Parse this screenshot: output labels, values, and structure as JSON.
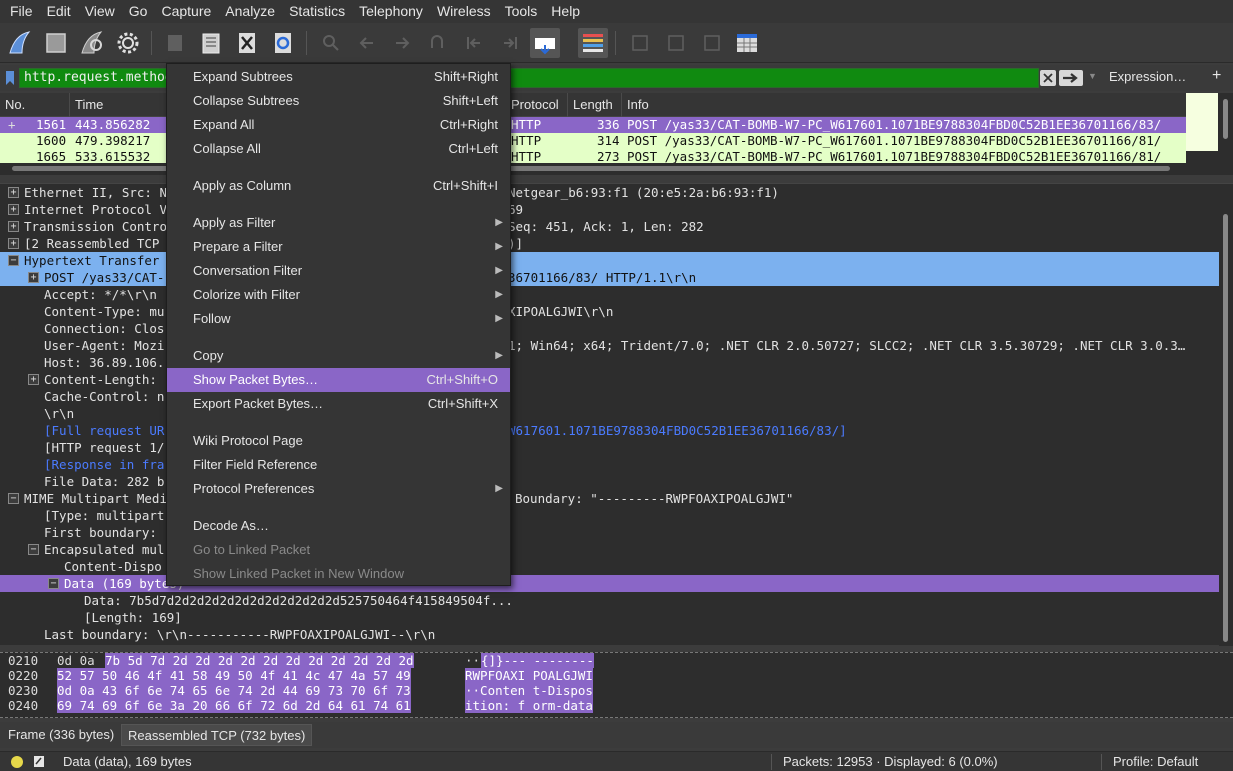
{
  "menubar": [
    "File",
    "Edit",
    "View",
    "Go",
    "Capture",
    "Analyze",
    "Statistics",
    "Telephony",
    "Wireless",
    "Tools",
    "Help"
  ],
  "toolbar": {
    "icons": [
      "shark-fin-start-icon",
      "stop-capture-icon",
      "restart-capture-icon",
      "capture-options-icon",
      "open-file-icon",
      "save-file-icon",
      "close-file-icon",
      "reload-file-icon",
      "find-packet-icon",
      "go-back-icon",
      "go-forward-icon",
      "go-to-packet-icon",
      "first-packet-icon",
      "last-packet-icon",
      "autoscroll-icon",
      "colorize-icon",
      "zoom-in-icon",
      "zoom-out-icon",
      "normal-size-icon",
      "resize-columns-icon"
    ]
  },
  "filter": {
    "value": "http.request.method ==",
    "expression_label": "Expression…",
    "add_label": "+"
  },
  "packet_list": {
    "columns": [
      "No.",
      "Time",
      "Protocol",
      "Length",
      "Info"
    ],
    "rows": [
      {
        "no": "1561",
        "time": "443.856282",
        "protocol": "HTTP",
        "length": "336",
        "info": "POST /yas33/CAT-BOMB-W7-PC_W617601.1071BE9788304FBD0C52B1EE36701166/83/"
      },
      {
        "no": "1600",
        "time": "479.398217",
        "protocol": "HTTP",
        "length": "314",
        "info": "POST /yas33/CAT-BOMB-W7-PC_W617601.1071BE9788304FBD0C52B1EE36701166/81/"
      },
      {
        "no": "1665",
        "time": "533.615532",
        "protocol": "HTTP",
        "length": "273",
        "info": "POST /yas33/CAT-BOMB-W7-PC_W617601.1071BE9788304FBD0C52B1EE36701166/81/"
      }
    ]
  },
  "details": {
    "rows": [
      {
        "left": "Ethernet II, Src: N",
        "right": "Netgear_b6:93:f1 (20:e5:2a:b6:93:f1)"
      },
      {
        "left": "Internet Protocol V",
        "right": "69"
      },
      {
        "left": "Transmission Contro",
        "right": "Seq: 451, Ack: 1, Len: 282"
      },
      {
        "left": "[2 Reassembled TCP",
        "right": ")]"
      },
      {
        "left": "Hypertext Transfer",
        "right": ""
      },
      {
        "left": "POST /yas33/CAT-",
        "right": "36701166/83/ HTTP/1.1\\r\\n"
      },
      {
        "left": "Accept: */*\\r\\n",
        "right": ""
      },
      {
        "left": "Content-Type: mu",
        "right": "XIPOALGJWI\\r\\n"
      },
      {
        "left": "Connection: Clos",
        "right": ""
      },
      {
        "left": "User-Agent: Mozi",
        "right": "1; Win64; x64; Trident/7.0; .NET CLR 2.0.50727; SLCC2; .NET CLR 3.5.30729; .NET CLR 3.0.3…"
      },
      {
        "left": "Host: 36.89.106.",
        "right": ""
      },
      {
        "left": "Content-Length: ",
        "right": ""
      },
      {
        "left": "Cache-Control: n",
        "right": ""
      },
      {
        "left": "\\r\\n",
        "right": ""
      },
      {
        "left": "[Full request UR",
        "right": "W617601.1071BE9788304FBD0C52B1EE36701166/83/]"
      },
      {
        "left": "[HTTP request 1/",
        "right": ""
      },
      {
        "left": "[Response in fra",
        "right": ""
      },
      {
        "left": "File Data: 282 b",
        "right": ""
      },
      {
        "left": "MIME Multipart Medi",
        "right": "Boundary: \"---------RWPFOAXIPOALGJWI\""
      },
      {
        "left": "[Type: multipart",
        "right": ""
      },
      {
        "left": "First boundary: ",
        "right": ""
      },
      {
        "left": "Encapsulated mul",
        "right": ""
      },
      {
        "left": "Content-Dispo",
        "right": ""
      },
      {
        "left": "Data (169 bytes)",
        "right": ""
      },
      {
        "left": "Data: 7b5d7d2d2d2d2d2d2d2d2d2d2d2d525750464f415849504f...",
        "right": ""
      },
      {
        "left": "[Length: 169]",
        "right": ""
      },
      {
        "left": "Last boundary: \\r\\n-----------RWPFOAXIPOALGJWI--\\r\\n",
        "right": ""
      }
    ]
  },
  "bytes": {
    "rows": [
      {
        "offset": "0210",
        "hex_pre": "0d 0a ",
        "hex_sel": "7b 5d 7d 2d 2d 2d  2d 2d 2d 2d 2d 2d 2d 2d",
        "ascii_pre": "··",
        "ascii_sel": "{]}--- --------"
      },
      {
        "offset": "0220",
        "hex_pre": "",
        "hex_sel": "52 57 50 46 4f 41 58 49  50 4f 41 4c 47 4a 57 49",
        "ascii_pre": "",
        "ascii_sel": "RWPFOAXI POALGJWI"
      },
      {
        "offset": "0230",
        "hex_pre": "",
        "hex_sel": "0d 0a 43 6f 6e 74 65 6e  74 2d 44 69 73 70 6f 73",
        "ascii_pre": "",
        "ascii_sel": "··Conten t-Dispos"
      },
      {
        "offset": "0240",
        "hex_pre": "",
        "hex_sel": "69 74 69 6f 6e 3a 20 66  6f 72 6d 2d 64 61 74 61",
        "ascii_pre": "",
        "ascii_sel": "ition: f orm-data"
      }
    ]
  },
  "byte_tabs": [
    "Frame (336 bytes)",
    "Reassembled TCP (732 bytes)"
  ],
  "statusbar": {
    "field": "Data (data), 169 bytes",
    "packets": "Packets: 12953 · Displayed: 6 (0.0%)",
    "profile": "Profile: Default"
  },
  "context_menu": {
    "items": [
      {
        "label": "Expand Subtrees",
        "shortcut": "Shift+Right"
      },
      {
        "label": "Collapse Subtrees",
        "shortcut": "Shift+Left"
      },
      {
        "label": "Expand All",
        "shortcut": "Ctrl+Right"
      },
      {
        "label": "Collapse All",
        "shortcut": "Ctrl+Left"
      },
      {
        "label": "Apply as Column",
        "shortcut": "Ctrl+Shift+I"
      },
      {
        "label": "Apply as Filter",
        "shortcut": ""
      },
      {
        "label": "Prepare a Filter",
        "shortcut": ""
      },
      {
        "label": "Conversation Filter",
        "shortcut": ""
      },
      {
        "label": "Colorize with Filter",
        "shortcut": ""
      },
      {
        "label": "Follow",
        "shortcut": ""
      },
      {
        "label": "Copy",
        "shortcut": ""
      },
      {
        "label": "Show Packet Bytes…",
        "shortcut": "Ctrl+Shift+O"
      },
      {
        "label": "Export Packet Bytes…",
        "shortcut": "Ctrl+Shift+X"
      },
      {
        "label": "Wiki Protocol Page",
        "shortcut": ""
      },
      {
        "label": "Filter Field Reference",
        "shortcut": ""
      },
      {
        "label": "Protocol Preferences",
        "shortcut": ""
      },
      {
        "label": "Decode As…",
        "shortcut": ""
      },
      {
        "label": "Go to Linked Packet",
        "shortcut": ""
      },
      {
        "label": "Show Linked Packet in New Window",
        "shortcut": ""
      }
    ]
  },
  "colors": {
    "selection": "#8a66c7",
    "http_row": "#e4ffc7",
    "filter_ok": "#108a10",
    "highlight": "#7cb1ef",
    "link": "#4b7bff"
  }
}
